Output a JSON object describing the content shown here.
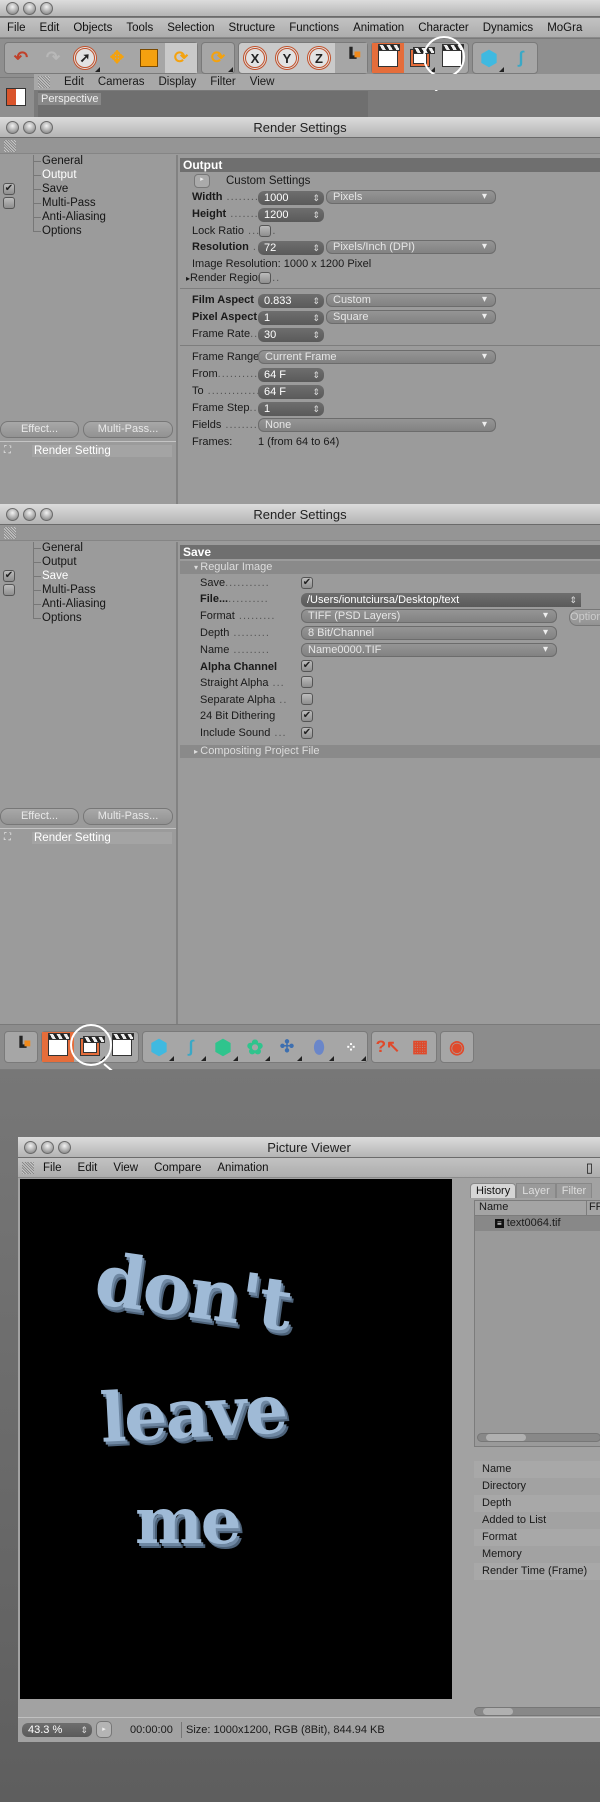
{
  "main_app": {
    "menu": [
      "File",
      "Edit",
      "Objects",
      "Tools",
      "Selection",
      "Structure",
      "Functions",
      "Animation",
      "Character",
      "Dynamics",
      "MoGra"
    ],
    "viewport_menu": [
      "Edit",
      "Cameras",
      "Display",
      "Filter",
      "View"
    ],
    "viewport_label": "Perspective",
    "toolbar_icons": [
      "undo-icon",
      "redo-icon",
      "live-selection-icon",
      "move-icon",
      "scale-icon",
      "rotate-icon",
      "rotate-recent-icon",
      "x-axis-lock-icon",
      "y-axis-lock-icon",
      "z-axis-lock-icon",
      "coordinate-system-icon",
      "render-view-icon",
      "render-active-view-icon",
      "render-settings-icon",
      "cube-icon",
      "spline-pen-icon"
    ],
    "axis_labels": [
      "X",
      "Y",
      "Z"
    ]
  },
  "render_settings_output": {
    "title": "Render Settings",
    "tree": [
      "General",
      "Output",
      "Save",
      "Multi-Pass",
      "Anti-Aliasing",
      "Options"
    ],
    "selected": "Output",
    "save_checked": true,
    "multipass_checked": false,
    "buttons": {
      "effect": "Effect...",
      "multipass": "Multi-Pass..."
    },
    "render_setting_item": "Render Setting",
    "section": "Output",
    "custom_settings": "Custom Settings",
    "fields": {
      "width": {
        "label": "Width",
        "value": "1000",
        "unit": "Pixels"
      },
      "height": {
        "label": "Height",
        "value": "1200"
      },
      "lock_ratio": {
        "label": "Lock Ratio",
        "checked": false
      },
      "resolution": {
        "label": "Resolution",
        "value": "72",
        "unit": "Pixels/Inch (DPI)"
      },
      "image_resolution": {
        "label": "Image Resolution:",
        "value": "1000 x 1200 Pixel"
      },
      "render_region": {
        "label": "Render Region",
        "checked": false
      },
      "film_aspect": {
        "label": "Film Aspect",
        "value": "0.833",
        "preset": "Custom"
      },
      "pixel_aspect": {
        "label": "Pixel Aspect",
        "value": "1",
        "preset": "Square"
      },
      "frame_rate": {
        "label": "Frame Rate",
        "value": "30"
      },
      "frame_range": {
        "label": "Frame Range",
        "value": "Current Frame"
      },
      "from": {
        "label": "From",
        "value": "64 F"
      },
      "to": {
        "label": "To",
        "value": "64 F"
      },
      "frame_step": {
        "label": "Frame Step",
        "value": "1"
      },
      "fields": {
        "label": "Fields",
        "value": "None"
      },
      "frames": {
        "label": "Frames:",
        "value": "1 (from 64 to 64)"
      }
    }
  },
  "render_settings_save": {
    "title": "Render Settings",
    "tree": [
      "General",
      "Output",
      "Save",
      "Multi-Pass",
      "Anti-Aliasing",
      "Options"
    ],
    "selected": "Save",
    "buttons": {
      "effect": "Effect...",
      "multipass": "Multi-Pass..."
    },
    "render_setting_item": "Render Setting",
    "section": "Save",
    "subsection": "Regular Image",
    "fields": {
      "save": {
        "label": "Save",
        "checked": true
      },
      "file": {
        "label": "File...",
        "value": "/Users/ionutciursa/Desktop/text"
      },
      "format": {
        "label": "Format",
        "value": "TIFF (PSD Layers)",
        "options_button": "Options"
      },
      "depth": {
        "label": "Depth",
        "value": "8 Bit/Channel"
      },
      "name": {
        "label": "Name",
        "value": "Name0000.TIF"
      },
      "alpha_channel": {
        "label": "Alpha Channel",
        "checked": true
      },
      "straight_alpha": {
        "label": "Straight Alpha",
        "checked": false
      },
      "separate_alpha": {
        "label": "Separate Alpha",
        "checked": false
      },
      "dithering": {
        "label": "24 Bit Dithering",
        "checked": true
      },
      "include_sound": {
        "label": "Include Sound",
        "checked": true
      }
    },
    "compositing": "Compositing Project File"
  },
  "picture_viewer": {
    "title": "Picture Viewer",
    "menu": [
      "File",
      "Edit",
      "View",
      "Compare",
      "Animation"
    ],
    "image_words": [
      "don't",
      "leave",
      "me"
    ],
    "tabs": [
      "History",
      "Layer",
      "Filter"
    ],
    "active_tab": "History",
    "list_headers": [
      "Name",
      "FP"
    ],
    "files": [
      "text0064.tif"
    ],
    "info_labels": [
      "Name",
      "Directory",
      "Depth",
      "Added to List",
      "Format",
      "Memory",
      "Render Time (Frame)"
    ],
    "zoom": "43.3 %",
    "timecode": "00:00:00",
    "size_info": "Size: 1000x1200, RGB (8Bit), 844.94 KB"
  },
  "colors": {
    "accent_orange": "#e56d3b",
    "panel_gray": "#9b9b9b",
    "header_gray": "#6f6f6f"
  }
}
